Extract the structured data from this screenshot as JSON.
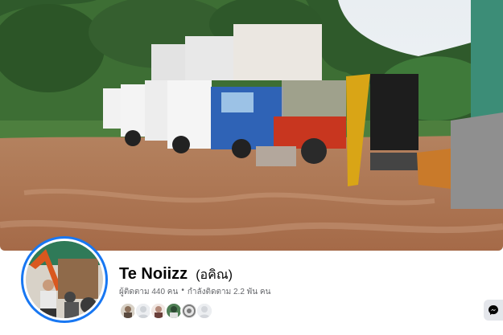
{
  "profile": {
    "name": "Te Noiizz",
    "alt_name": "(อคิณ)",
    "followers_text": "ผู้ติดตาม 440 คน",
    "separator": "•",
    "following_text": "กำลังติดตาม 2.2 พัน คน"
  },
  "cover": {
    "description_icon": "cover-photo"
  },
  "friends": [
    {
      "icon": "friend-avatar-1",
      "color": "#8a6f5a"
    },
    {
      "icon": "friend-avatar-2",
      "color": "#cfd3d8"
    },
    {
      "icon": "friend-avatar-3",
      "color": "#b48a7a"
    },
    {
      "icon": "friend-avatar-4",
      "color": "#3f6a4a"
    },
    {
      "icon": "friend-avatar-5",
      "color": "#7b7b7b"
    },
    {
      "icon": "friend-avatar-6",
      "color": "#d3d6db"
    }
  ],
  "actions": {
    "messenger_icon": "messenger-icon"
  },
  "colors": {
    "accent": "#1877f2",
    "secondary_text": "#65676b",
    "button_bg": "#e4e6eb"
  }
}
